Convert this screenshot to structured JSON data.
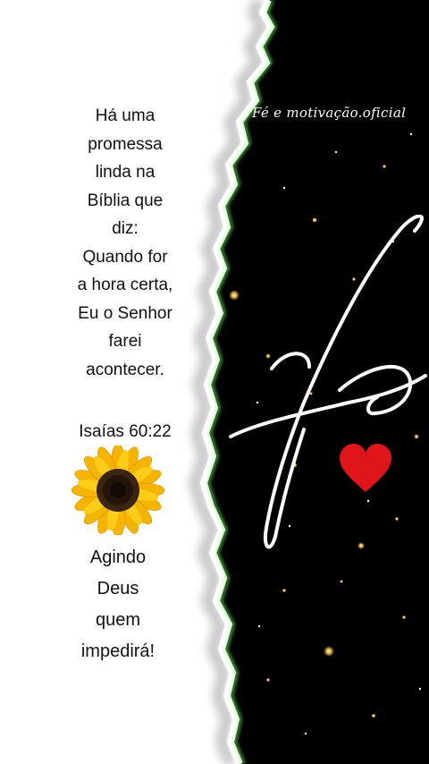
{
  "message": {
    "lines": [
      "Há uma",
      "promessa",
      "linda na",
      "Bíblia que",
      "diz:",
      "Quando for",
      "a hora certa,",
      "Eu o Senhor",
      "farei",
      "acontecer."
    ],
    "reference": "Isaías 60:22",
    "closing_lines": [
      "Agindo",
      "Deus",
      "quem",
      "impedirá!"
    ]
  },
  "brand": {
    "watermark": "Fé e motivação.oficial",
    "script_word": "Fé"
  },
  "icons": {
    "flower": "sunflower-icon",
    "heart": "heart-icon"
  },
  "colors": {
    "background_dark": "#000000",
    "paper": "#ffffff",
    "glow": "#7dff6a",
    "heart": "#e0151b",
    "sparkle": "#ffcc55"
  }
}
